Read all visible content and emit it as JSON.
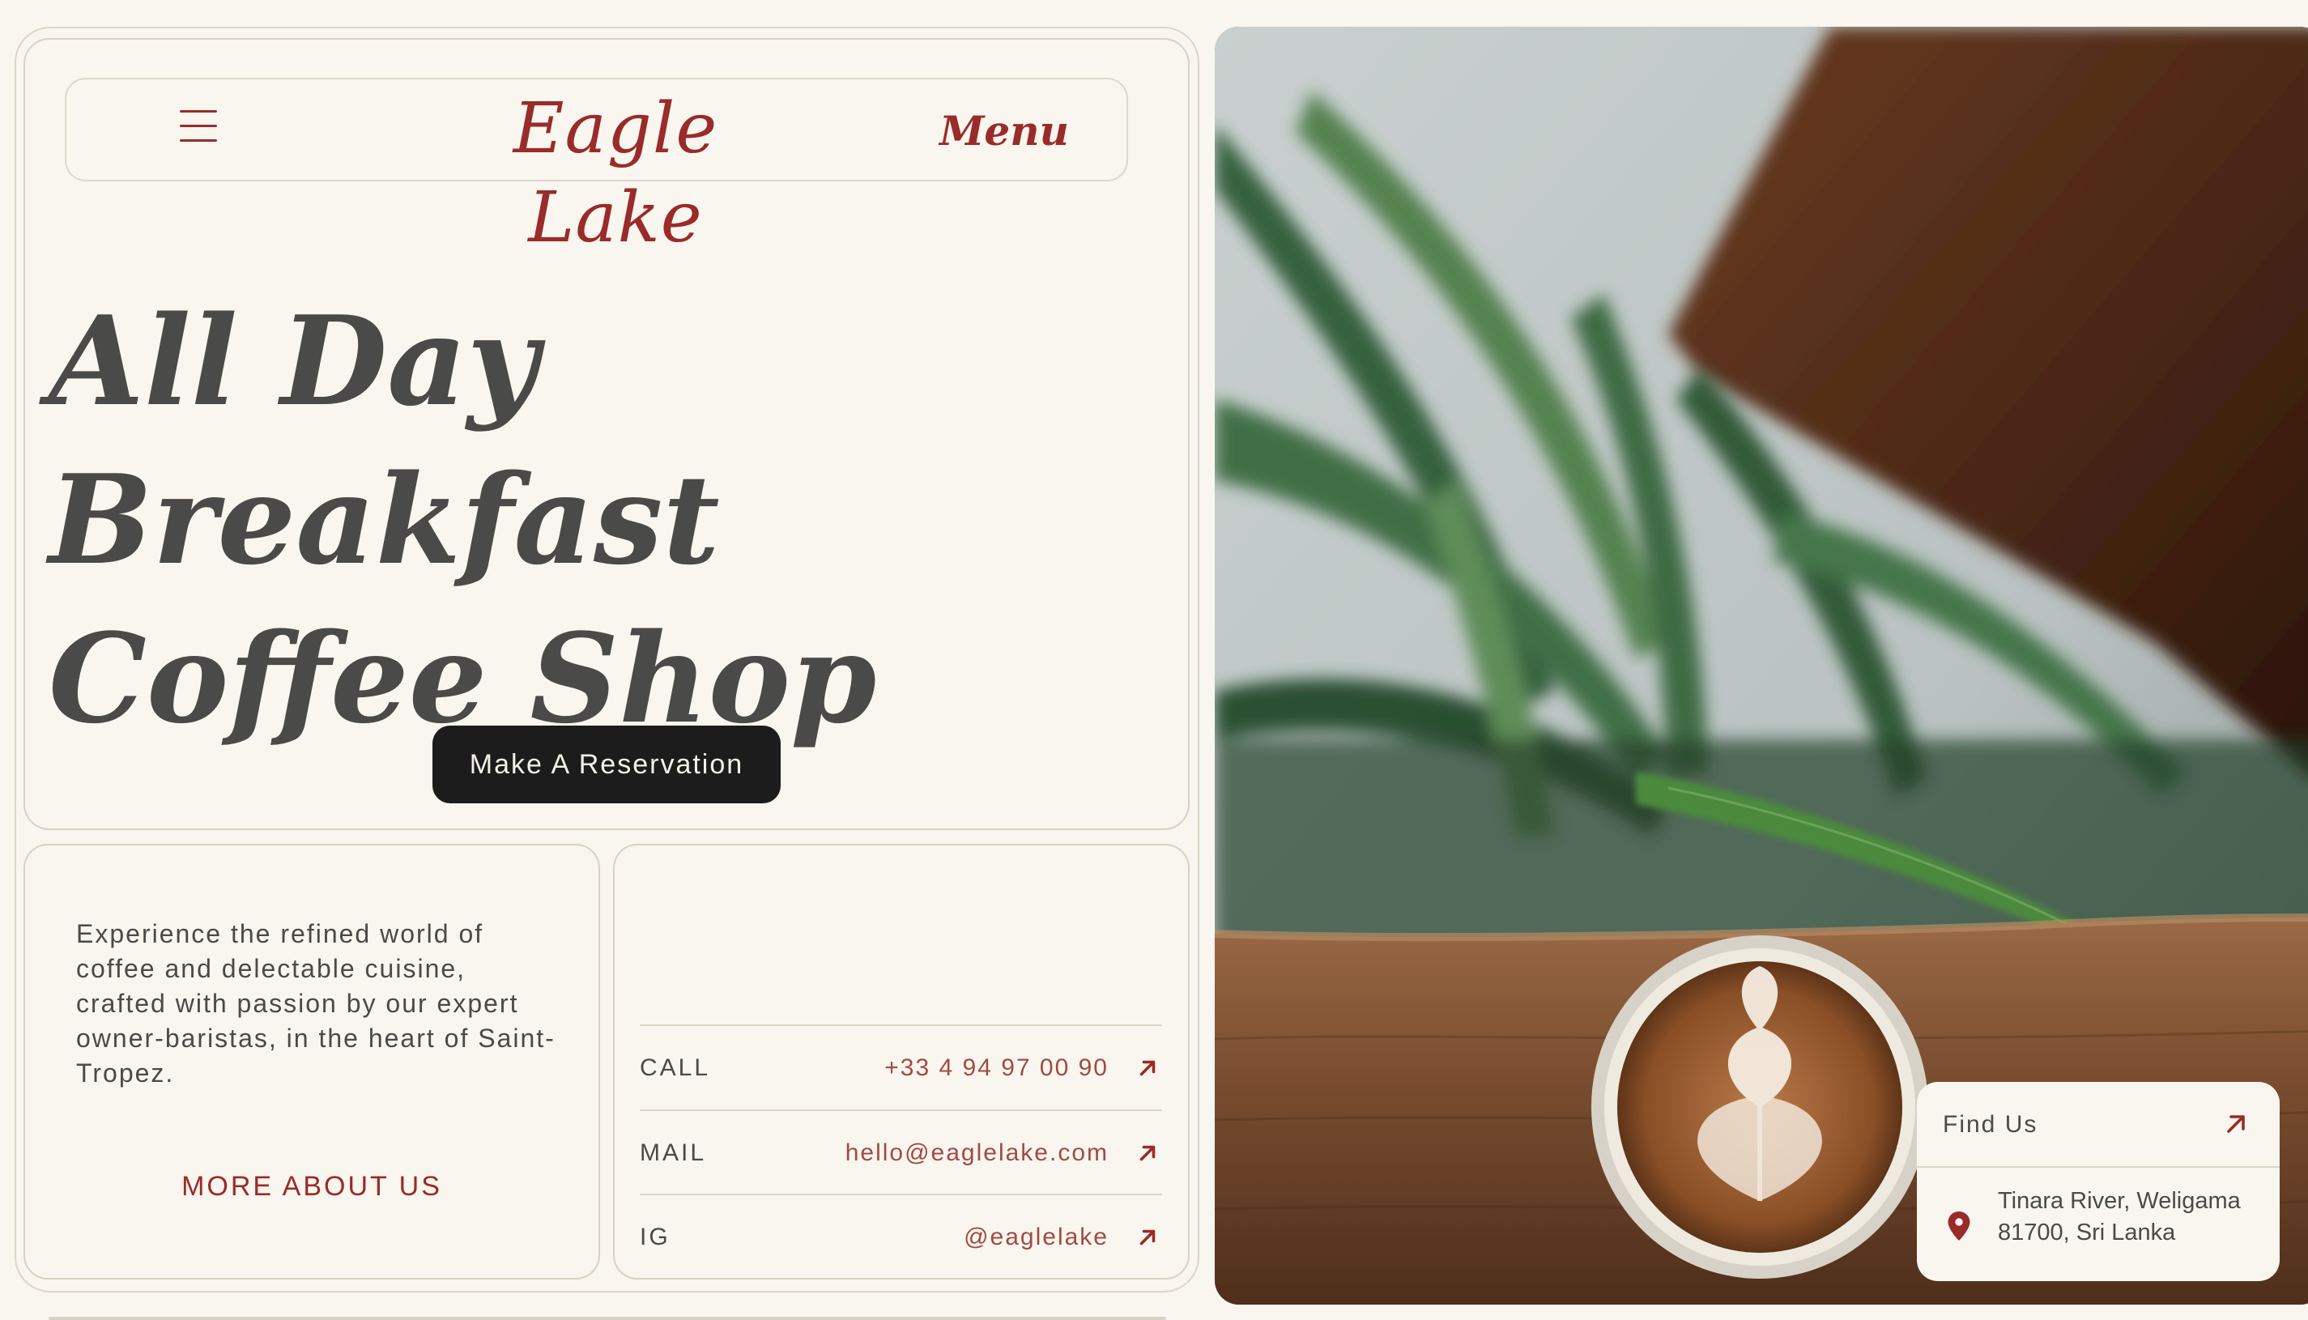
{
  "header": {
    "logo": "Eagle Lake",
    "menu_label": "Menu"
  },
  "hero": {
    "title_line1": "All Day Breakfast",
    "title_line2": "Coffee Shop",
    "cta_label": "Make A Reservation"
  },
  "about": {
    "text": "Experience the refined world of coffee and delectable cuisine, crafted with passion by our expert owner-baristas, in the heart of Saint-Tropez.",
    "link_label": "MORE ABOUT US"
  },
  "contact": {
    "rows": [
      {
        "label": "CALL",
        "value": "+33 4 94 97 00 90"
      },
      {
        "label": "MAIL",
        "value": "hello@eaglelake.com"
      },
      {
        "label": "IG",
        "value": "@eaglelake"
      }
    ]
  },
  "find_us": {
    "title": "Find Us",
    "address_line1": "Tinara River, Weligama",
    "address_line2": "81700, Sri Lanka"
  },
  "icons": {
    "menu": "hamburger-icon",
    "arrow": "arrow-up-right-icon",
    "location": "map-pin-icon"
  },
  "colors": {
    "background": "#f8f6ee",
    "accent": "#9a2b2b",
    "text": "#4a4a48",
    "button": "#1c1c1c"
  }
}
